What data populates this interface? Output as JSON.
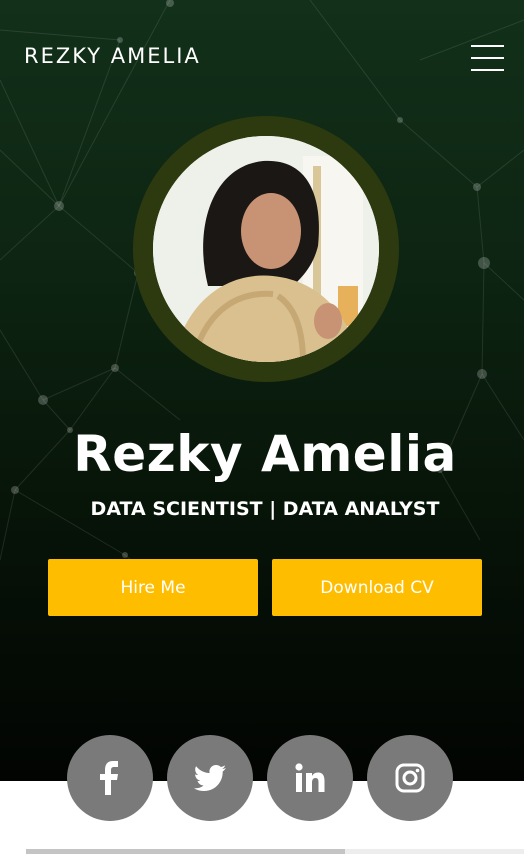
{
  "header": {
    "brand": "REZKY AMELIA",
    "menu_icon": "hamburger-menu-icon"
  },
  "hero": {
    "avatar_alt": "profile photo",
    "name": "Rezky Amelia",
    "subtitle": "DATA SCIENTIST | DATA ANALYST",
    "buttons": {
      "hire": "Hire Me",
      "download_cv": "Download CV"
    }
  },
  "socials": [
    {
      "icon": "facebook-icon"
    },
    {
      "icon": "twitter-icon"
    },
    {
      "icon": "linkedin-icon"
    },
    {
      "icon": "instagram-icon"
    }
  ],
  "colors": {
    "accent": "#ffbd00",
    "hero_bg": "#0d2412",
    "social_bg": "#7a7a7a"
  }
}
